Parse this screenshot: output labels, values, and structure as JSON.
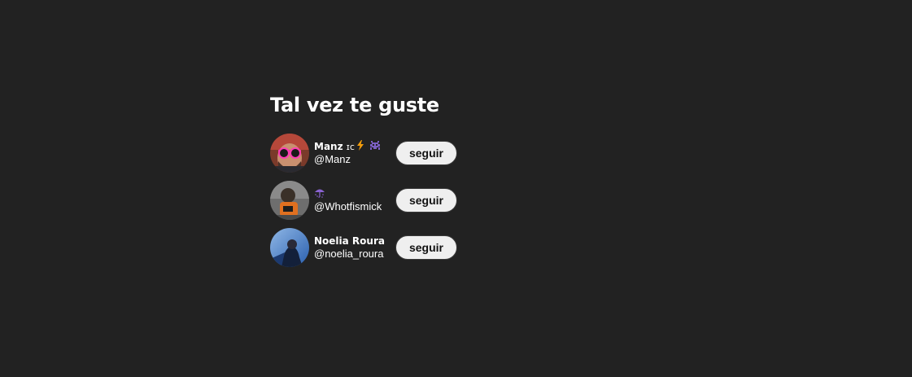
{
  "section": {
    "title": "Tal vez te guste"
  },
  "suggestions": [
    {
      "name": "Manz ",
      "handle": "@Manz",
      "badges": [
        "ic-ideograph",
        "lightning-icon",
        "alien-monster-icon"
      ],
      "button_label": "seguir"
    },
    {
      "name": "",
      "handle": "@Whotfismick",
      "badges": [
        "umbrella-rain-icon"
      ],
      "button_label": "seguir"
    },
    {
      "name": "Noelia Roura",
      "handle": "@noelia_roura",
      "badges": [],
      "button_label": "seguir"
    }
  ],
  "colors": {
    "background": "#222222",
    "text": "#ffffff",
    "button_bg": "#efefef",
    "button_text": "#111111",
    "lightning": "#f59e0b",
    "alien": "#7c5fc4",
    "umbrella": "#8a63d2"
  }
}
